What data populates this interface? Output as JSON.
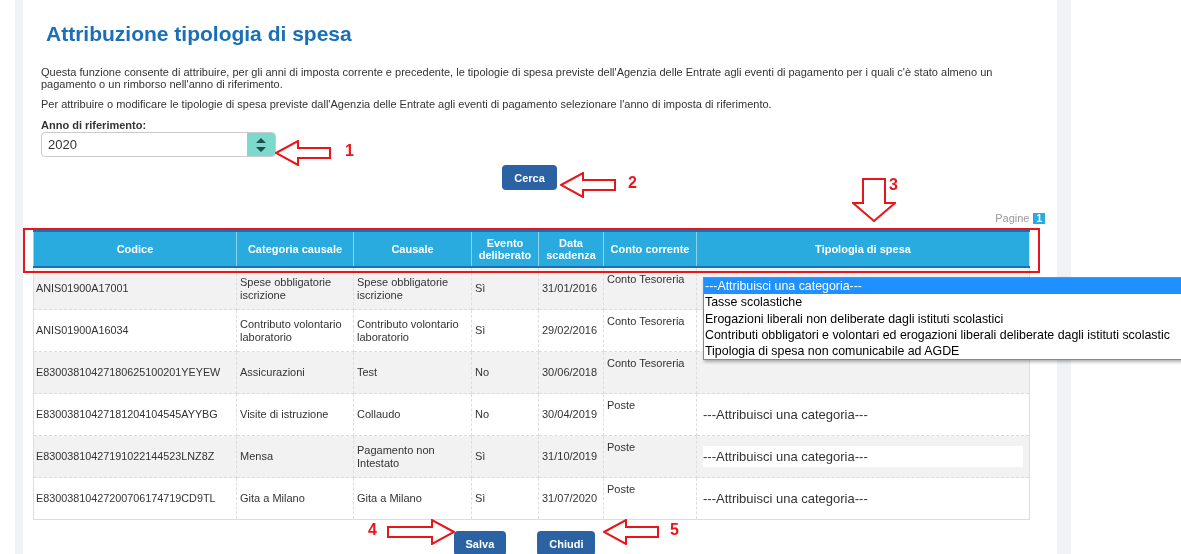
{
  "title": "Attribuzione tipologia di spesa",
  "intro": [
    "Questa funzione consente di attribuire, per gli anni di imposta corrente e precedente, le tipologie di spesa previste dell'Agenzia delle Entrate agli eventi di pagamento per i quali c'è stato almeno un pagamento o un rimborso nell'anno di riferimento.",
    "Per attribuire o modificare le tipologie di spesa previste dall'Agenzia delle Entrate agli eventi di pagamento selezionare l'anno di imposta di riferimento."
  ],
  "year_field": {
    "label": "Anno di riferimento:",
    "value": "2020"
  },
  "search_button": "Cerca",
  "pagination": {
    "label": "Pagine",
    "pages": [
      {
        "label": "1",
        "selected": true
      }
    ]
  },
  "table": {
    "columns": [
      "Codice",
      "Categoria causale",
      "Causale",
      "Evento deliberato",
      "Data scadenza",
      "Conto corrente",
      "Tipologia di spesa"
    ],
    "rows": [
      {
        "codice": "ANIS01900A17001",
        "categoria": "Spese obbligatorie iscrizione",
        "causale": "Spese obbligatorie iscrizione",
        "evento": "Sì",
        "data": "31/01/2016",
        "conto": "Conto Tesoreria"
      },
      {
        "codice": "ANIS01900A16034",
        "categoria": "Contributo volontario laboratorio",
        "causale": "Contributo volontario laboratorio",
        "evento": "Sì",
        "data": "29/02/2016",
        "conto": "Conto Tesoreria"
      },
      {
        "codice": "E83003810427180625100201YEYEW",
        "categoria": "Assicurazioni",
        "causale": "Test",
        "evento": "No",
        "data": "30/06/2018",
        "conto": "Conto Tesoreria"
      },
      {
        "codice": "E83003810427181204104545AYYBG",
        "categoria": "Visite di istruzione",
        "causale": "Collaudo",
        "evento": "No",
        "data": "30/04/2019",
        "conto": "Poste",
        "tipologia": "---Attribuisci una categoria---"
      },
      {
        "codice": "E83003810427191022144523LNZ8Z",
        "categoria": "Mensa",
        "causale": "Pagamento non Intestato",
        "evento": "Sì",
        "data": "31/10/2019",
        "conto": "Poste",
        "tipologia": "---Attribuisci una categoria---"
      },
      {
        "codice": "E83003810427200706174719CD9TL",
        "categoria": "Gita a Milano",
        "causale": "Gita a Milano",
        "evento": "Sì",
        "data": "31/07/2020",
        "conto": "Poste",
        "tipologia": "---Attribuisci una categoria---"
      }
    ]
  },
  "dropdown_options": [
    {
      "label": "---Attribuisci una categoria---",
      "selected": true
    },
    {
      "label": "Tasse scolastiche",
      "selected": false
    },
    {
      "label": "Erogazioni liberali non deliberate dagli istituti scolastici",
      "selected": false
    },
    {
      "label": "Contributi obbligatori e volontari ed erogazioni liberali deliberate dagli istituti scolastic",
      "selected": false
    },
    {
      "label": "Tipologia di spesa non comunicabile ad AGDE",
      "selected": false
    }
  ],
  "buttons": [
    "Salva",
    "Chiudi"
  ],
  "annotations": [
    {
      "label": "1",
      "kind": "left"
    },
    {
      "label": "2",
      "kind": "left"
    },
    {
      "label": "3",
      "kind": "down"
    },
    {
      "label": "4",
      "kind": "right"
    },
    {
      "label": "5",
      "kind": "left"
    }
  ]
}
